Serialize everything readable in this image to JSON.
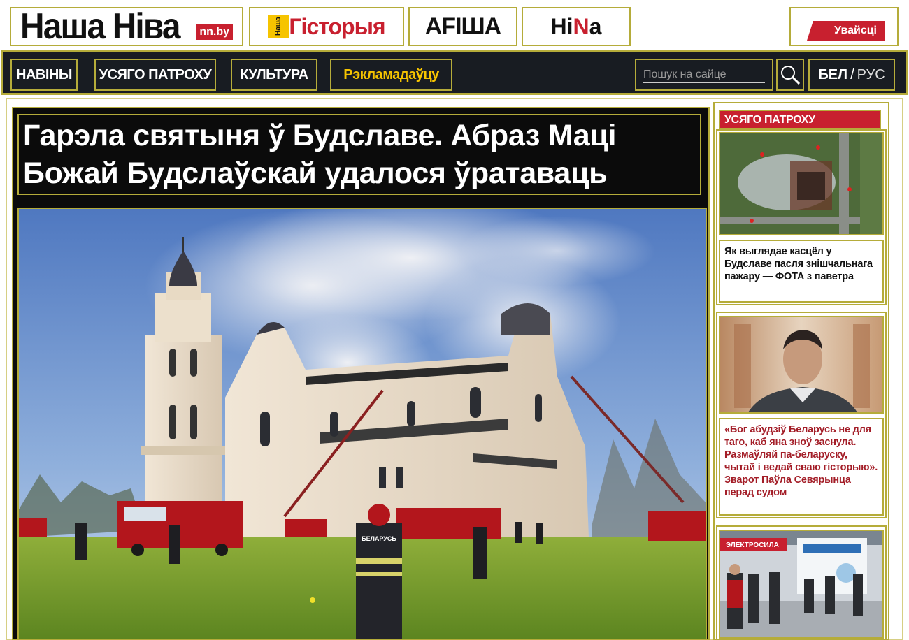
{
  "brand": {
    "logo": "Наша Ніва",
    "logo_badge": "nn.by",
    "history_tag": "Наша",
    "history": "Гісторыя",
    "afisha": "AFIША",
    "hina_a": "Hi",
    "hina_b": "N",
    "hina_c": "a"
  },
  "header": {
    "login_label": "Увайсці"
  },
  "nav": {
    "items": [
      {
        "label": "НАВІНЫ"
      },
      {
        "label": "УСЯГО ПАТРОХУ"
      },
      {
        "label": "КУЛЬТУРА"
      },
      {
        "label": "Рэкламадаўцу"
      }
    ],
    "search_placeholder": "Пошук на сайце",
    "lang_active": "БЕЛ",
    "lang_sep": "/",
    "lang_inactive": "РУС"
  },
  "article": {
    "headline": "Гарэла святыня ў Будславе. Абраз Маці Божай Будслаўскай удалося ўратаваць",
    "hero_vest_text": "БЕЛАРУСЬ"
  },
  "sidebar": {
    "section_label": "УСЯГО ПАТРОХУ",
    "cards": [
      {
        "title": "Як выглядае касцёл у Будславе пасля знішчальнага пажару — ФОТА з паветра"
      },
      {
        "title": "«Бог абудзіў Беларусь не для таго, каб яна зноў заснула. Размаўляй па-беларуску, чытай і ведай сваю гісторыю». Зварот Паўла Севярынца перад судом"
      },
      {
        "sign": "ЭЛЕКТРОСИЛА"
      }
    ]
  },
  "colors": {
    "accent_red": "#c8202f",
    "nav_bg": "#181c22",
    "ad_yellow": "#f6c400"
  }
}
